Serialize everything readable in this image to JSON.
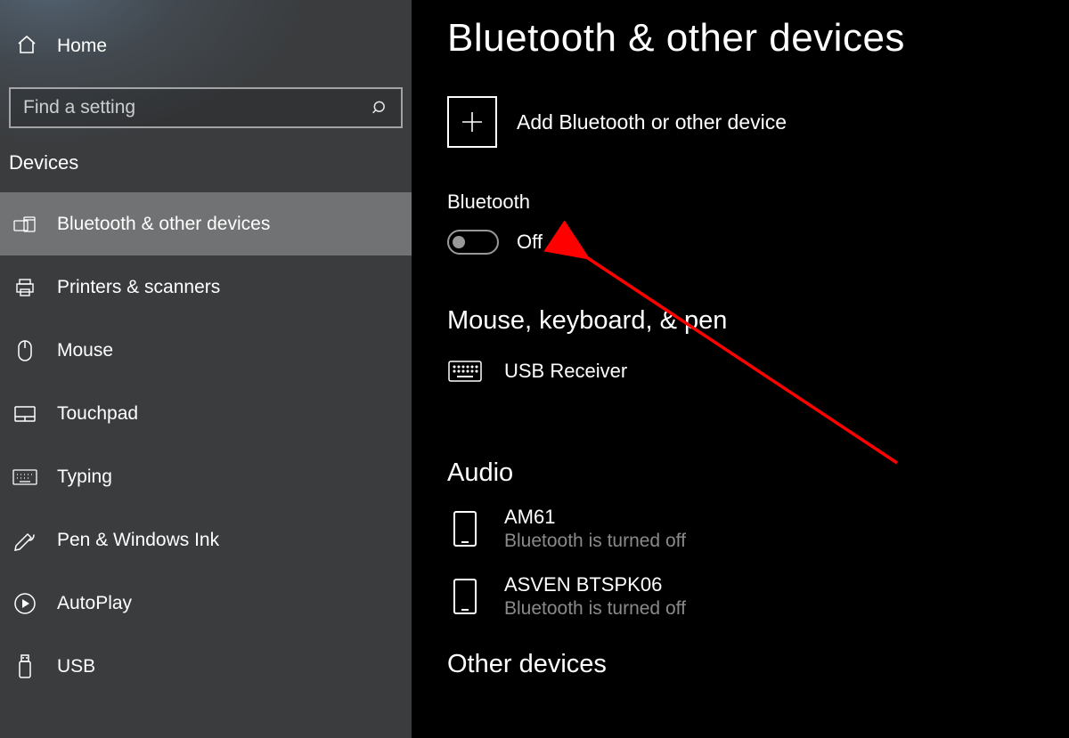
{
  "sidebar": {
    "home": "Home",
    "search_placeholder": "Find a setting",
    "section": "Devices",
    "items": [
      {
        "key": "bluetooth",
        "label": "Bluetooth & other devices",
        "active": true
      },
      {
        "key": "printers",
        "label": "Printers & scanners"
      },
      {
        "key": "mouse",
        "label": "Mouse"
      },
      {
        "key": "touchpad",
        "label": "Touchpad"
      },
      {
        "key": "typing",
        "label": "Typing"
      },
      {
        "key": "pen",
        "label": "Pen & Windows Ink"
      },
      {
        "key": "autoplay",
        "label": "AutoPlay"
      },
      {
        "key": "usb",
        "label": "USB"
      }
    ]
  },
  "content": {
    "title": "Bluetooth & other devices",
    "add_label": "Add Bluetooth or other device",
    "bluetooth": {
      "label": "Bluetooth",
      "state": "Off"
    },
    "mouse_section": {
      "heading": "Mouse, keyboard, & pen",
      "devices": [
        {
          "name": "USB Receiver",
          "status": ""
        }
      ]
    },
    "audio_section": {
      "heading": "Audio",
      "devices": [
        {
          "name": "AM61",
          "status": "Bluetooth is turned off"
        },
        {
          "name": "ASVEN BTSPK06",
          "status": "Bluetooth is turned off"
        }
      ]
    },
    "other_section_heading": "Other devices"
  },
  "annotation": {
    "color": "#ff0000"
  }
}
